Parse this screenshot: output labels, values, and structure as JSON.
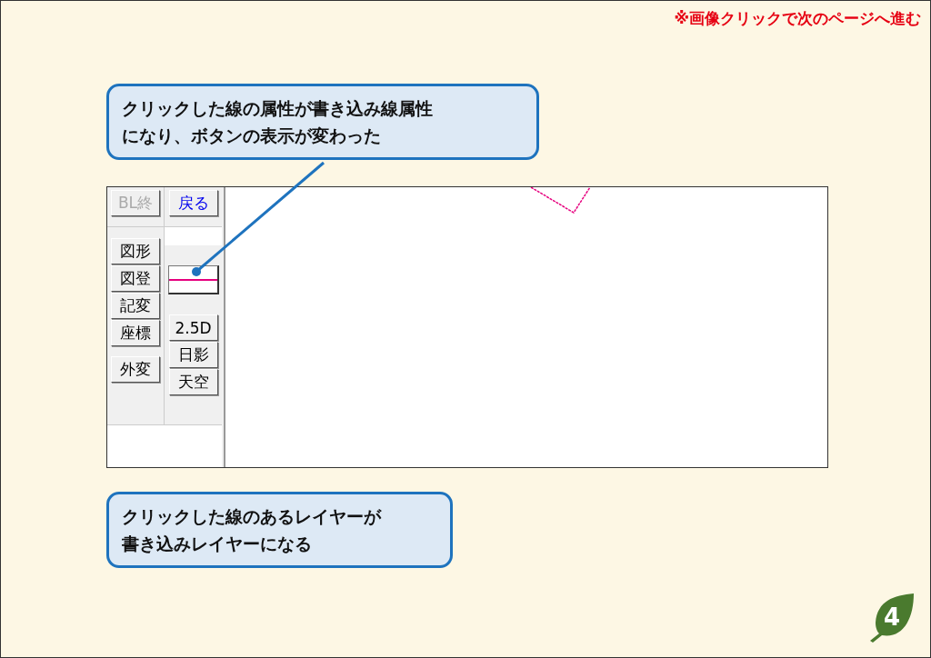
{
  "header_note": "※画像クリックで次のページへ進む",
  "callouts": [
    {
      "lines": [
        "クリックした線の属性が書き込み線属性",
        "になり、ボタンの表示が変わった"
      ]
    },
    {
      "lines": [
        "クリックした線のあるレイヤーが",
        "書き込みレイヤーになる"
      ]
    }
  ],
  "toolbar": {
    "top_buttons": [
      {
        "label": "BL終",
        "disabled": true,
        "kind": "plain"
      },
      {
        "label": "戻る",
        "disabled": false,
        "kind": "accent"
      }
    ],
    "left_buttons": [
      {
        "label": "図形"
      },
      {
        "label": "図登"
      },
      {
        "label": "記変"
      },
      {
        "label": "座標"
      },
      {
        "label": "外変"
      }
    ],
    "right_buttons": [
      {
        "label": "2.5D"
      },
      {
        "label": "日影"
      },
      {
        "label": "天空"
      }
    ]
  },
  "page_number": "4"
}
